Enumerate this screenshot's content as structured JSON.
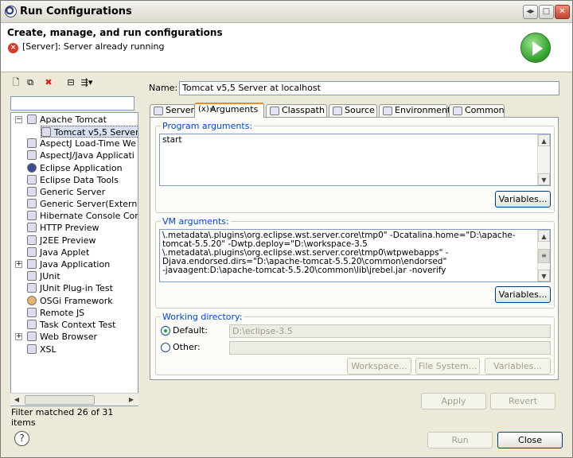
{
  "window": {
    "title": "Run Configurations"
  },
  "header": {
    "title": "Create, manage, and run configurations",
    "message": "[Server]: Server already running"
  },
  "left": {
    "filter_value": "",
    "tree": [
      {
        "label": "Apache Tomcat",
        "expanded": true
      },
      {
        "label": "Tomcat v5,5 Server",
        "selected": true
      },
      {
        "label": "AspectJ Load-Time We"
      },
      {
        "label": "AspectJ/Java Applicati"
      },
      {
        "label": "Eclipse Application"
      },
      {
        "label": "Eclipse Data Tools"
      },
      {
        "label": "Generic Server"
      },
      {
        "label": "Generic Server(Externa"
      },
      {
        "label": "Hibernate Console Cor"
      },
      {
        "label": "HTTP Preview"
      },
      {
        "label": "J2EE Preview"
      },
      {
        "label": "Java Applet"
      },
      {
        "label": "Java Application"
      },
      {
        "label": "JUnit"
      },
      {
        "label": "JUnit Plug-in Test"
      },
      {
        "label": "OSGi Framework"
      },
      {
        "label": "Remote JS"
      },
      {
        "label": "Task Context Test"
      },
      {
        "label": "Web Browser"
      },
      {
        "label": "XSL"
      }
    ],
    "filter_message": "Filter matched 26 of 31 items"
  },
  "right": {
    "name_label": "Name:",
    "name_value": "Tomcat v5,5 Server at localhost",
    "tabs": [
      "Server",
      "Arguments",
      "Classpath",
      "Source",
      "Environment",
      "Common"
    ],
    "active_tab": "Arguments",
    "program_args_label": "Program arguments:",
    "program_args_value": "start",
    "variables_label": "Variables...",
    "vm_args_label": "VM arguments:",
    "vm_args_lines": [
      "\\.metadata\\.plugins\\org.eclipse.wst.server.core\\tmp0\" -Dcatalina.home=\"D:\\apache-",
      "tomcat-5.5.20\" -Dwtp.deploy=\"D:\\workspace-3.5",
      "\\.metadata\\.plugins\\org.eclipse.wst.server.core\\tmp0\\wtpwebapps\" -",
      "Djava.endorsed.dirs=\"D:\\apache-tomcat-5.5.20\\common\\endorsed\"",
      "-javaagent:D:\\apache-tomcat-5.5.20\\common\\lib\\jrebel.jar -noverify"
    ],
    "working_dir_label": "Working directory:",
    "default_label": "Default:",
    "default_value": "D:\\eclipse-3.5",
    "other_label": "Other:",
    "other_value": "",
    "workspace_btn": "Workspace...",
    "filesystem_btn": "File System...",
    "variables2_btn": "Variables...",
    "apply_btn": "Apply",
    "revert_btn": "Revert"
  },
  "footer": {
    "help": "?",
    "run_btn": "Run",
    "close_btn": "Close"
  }
}
